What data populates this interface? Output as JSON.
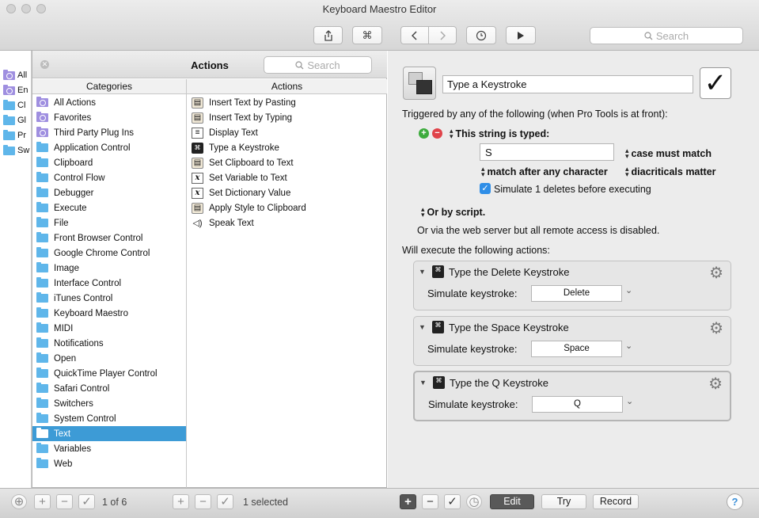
{
  "window": {
    "title": "Keyboard Maestro Editor"
  },
  "toolbar": {
    "search_placeholder": "Search",
    "command_glyph": "⌘"
  },
  "left_groups": [
    "All",
    "En",
    "Cl",
    "Gl",
    "Pr",
    "Sw"
  ],
  "actions_panel": {
    "title": "Actions",
    "search_placeholder": "Search",
    "categories_header": "Categories",
    "actions_header": "Actions",
    "categories": [
      "All Actions",
      "Favorites",
      "Third Party Plug Ins",
      "Application Control",
      "Clipboard",
      "Control Flow",
      "Debugger",
      "Execute",
      "File",
      "Front Browser Control",
      "Google Chrome Control",
      "Image",
      "Interface Control",
      "iTunes Control",
      "Keyboard Maestro",
      "MIDI",
      "Notifications",
      "Open",
      "QuickTime Player Control",
      "Safari Control",
      "Switchers",
      "System Control",
      "Text",
      "Variables",
      "Web"
    ],
    "selected_category": "Text",
    "actions": [
      {
        "label": "Insert Text by Pasting",
        "icon": "clipboard-icon"
      },
      {
        "label": "Insert Text by Typing",
        "icon": "clipboard-icon"
      },
      {
        "label": "Display Text",
        "icon": "document-icon"
      },
      {
        "label": "Type a Keystroke",
        "icon": "keystroke-icon"
      },
      {
        "label": "Set Clipboard to Text",
        "icon": "clipboard-icon"
      },
      {
        "label": "Set Variable to Text",
        "icon": "variable-icon"
      },
      {
        "label": "Set Dictionary Value",
        "icon": "variable-icon"
      },
      {
        "label": "Apply Style to Clipboard",
        "icon": "clipboard-icon"
      },
      {
        "label": "Speak Text",
        "icon": "speaker-icon"
      }
    ]
  },
  "macro": {
    "name": "Type a Keystroke",
    "trigger_heading": "Triggered by any of the following (when Pro Tools is at front):",
    "trigger_type": "This string is typed:",
    "typed_string": "S",
    "case_option": "case must match",
    "match_option": "match after any character",
    "diacritical_option": "diacriticals matter",
    "simulate_deletes": "Simulate 1 deletes before executing",
    "or_script": "Or by script.",
    "web_server": "Or via the web server but all remote access is disabled.",
    "execute_heading": "Will execute the following actions:",
    "actions": [
      {
        "title": "Type the Delete Keystroke",
        "label": "Simulate keystroke:",
        "key": "Delete"
      },
      {
        "title": "Type the Space Keystroke",
        "label": "Simulate keystroke:",
        "key": "Space"
      },
      {
        "title": "Type the Q Keystroke",
        "label": "Simulate keystroke:",
        "key": "Q"
      }
    ]
  },
  "bottom": {
    "group_count": "1 of 6",
    "selection": "1 selected",
    "edit": "Edit",
    "try": "Try",
    "record": "Record",
    "help": "?"
  }
}
